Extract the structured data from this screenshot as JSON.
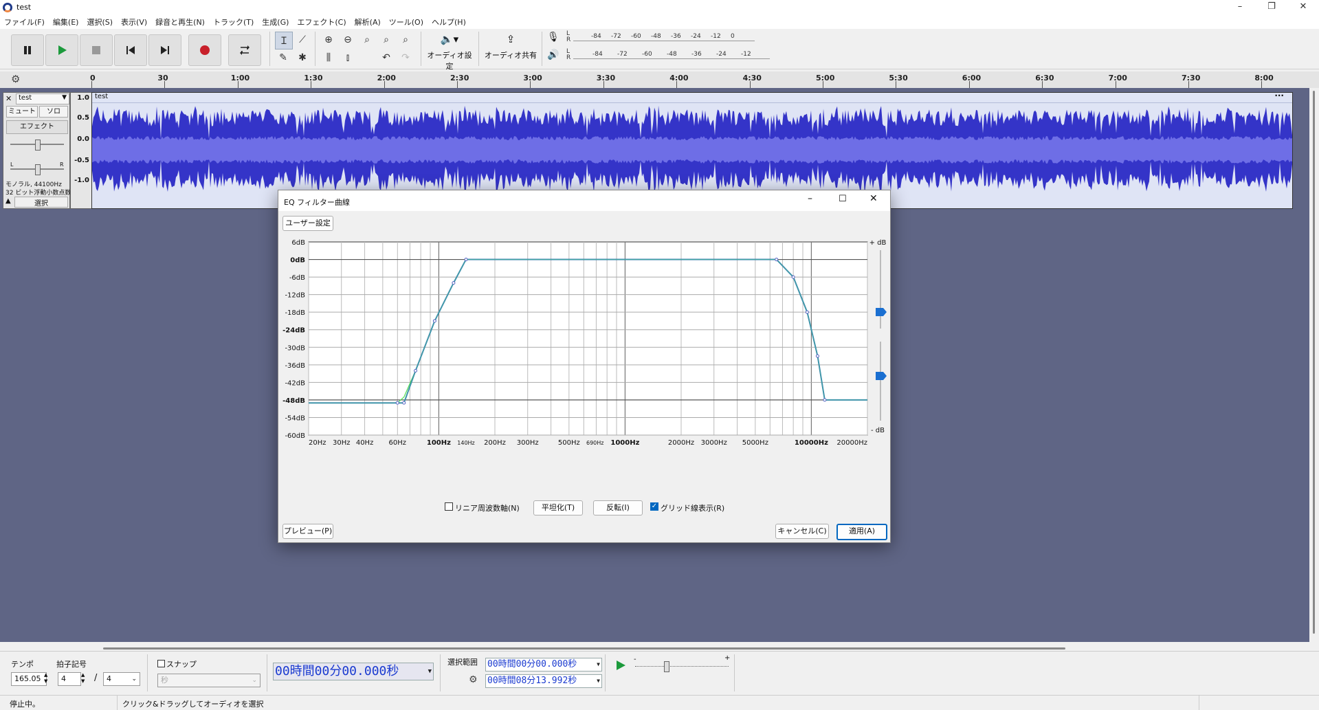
{
  "window": {
    "title": "test"
  },
  "menu": [
    "ファイル(F)",
    "編集(E)",
    "選択(S)",
    "表示(V)",
    "録音と再生(N)",
    "トラック(T)",
    "生成(G)",
    "エフェクト(C)",
    "解析(A)",
    "ツール(O)",
    "ヘルプ(H)"
  ],
  "toolbar": {
    "audio_setup_label": "オーディオ設定",
    "share_audio_label": "オーディオ共有",
    "meter_ticks": [
      "-84",
      "-72",
      "-60",
      "-48",
      "-36",
      "-24",
      "-12",
      "0"
    ],
    "meter_ticks_play": [
      "-84",
      "-72",
      "-60",
      "-48",
      "-36",
      "-24",
      "-12"
    ],
    "meter_L": "L",
    "meter_R": "R"
  },
  "ruler": {
    "ticks": [
      "0",
      "30",
      "1:00",
      "1:30",
      "2:00",
      "2:30",
      "3:00",
      "3:30",
      "4:00",
      "4:30",
      "5:00",
      "5:30",
      "6:00",
      "6:30",
      "7:00",
      "7:30",
      "8:00"
    ]
  },
  "track": {
    "name": "test",
    "clip_name": "test",
    "mute": "ミュート",
    "solo": "ソロ",
    "effect": "エフェクト",
    "pan_L": "L",
    "pan_R": "R",
    "info1": "モノラル, 44100Hz",
    "info2": "32 ビット浮動小数点数",
    "select": "選択",
    "scale": [
      "1.0",
      "0.5",
      "0.0",
      "-0.5",
      "-1.0"
    ]
  },
  "dialog": {
    "title": "EQ フィルター曲線",
    "preset_button": "ユーザー設定",
    "db_labels": [
      "6dB",
      "0dB",
      "-6dB",
      "-12dB",
      "-18dB",
      "-24dB",
      "-30dB",
      "-36dB",
      "-42dB",
      "-48dB",
      "-54dB",
      "-60dB"
    ],
    "freq_labels": [
      "20Hz",
      "30Hz",
      "40Hz",
      "60Hz",
      "100Hz",
      "140Hz",
      "200Hz",
      "300Hz",
      "500Hz",
      "690Hz",
      "1000Hz",
      "2000Hz",
      "3000Hz",
      "5000Hz",
      "10000Hz",
      "20000Hz"
    ],
    "plus_db": "+ dB",
    "minus_db": "- dB",
    "linear_freq_label": "リニア周波数軸(N)",
    "linear_freq_checked": false,
    "flatten_button": "平坦化(T)",
    "invert_button": "反転(I)",
    "grid_label": "グリッド線表示(R)",
    "grid_checked": true,
    "preview_button": "プレビュー(P)",
    "cancel_button": "キャンセル(C)",
    "apply_button": "適用(A)"
  },
  "chart_data": {
    "type": "line",
    "xscale": "log",
    "xlim": [
      20,
      20000
    ],
    "ylim": [
      -60,
      6
    ],
    "xlabel": "",
    "ylabel": "",
    "series": [
      {
        "x": [
          20,
          60,
          65,
          75,
          95,
          120,
          140,
          6500,
          8000,
          9500,
          10800,
          11800,
          20000
        ],
        "y": [
          -49,
          -49,
          -49,
          -38,
          -21,
          -8,
          0,
          0,
          -6,
          -18,
          -33,
          -48,
          -48
        ]
      }
    ],
    "control_points": {
      "x": [
        60,
        65,
        75,
        95,
        120,
        140,
        6500,
        8000,
        9500,
        10800,
        11800
      ],
      "y": [
        -49,
        -49,
        -38,
        -21,
        -8,
        0,
        0,
        -6,
        -18,
        -33,
        -48
      ]
    }
  },
  "bottom": {
    "tempo_label": "テンポ",
    "tempo_value": "165.05",
    "timesig_label": "拍子記号",
    "timesig_num": "4",
    "timesig_den": "4",
    "timesig_slash": "/",
    "snap_label": "スナップ",
    "snap_unit": "秒",
    "time_display": "00時間00分00.000秒",
    "selection_label": "選択範囲",
    "sel_start": "00時間00分00.000秒",
    "sel_end": "00時間08分13.992秒"
  },
  "status": {
    "state": "停止中。",
    "hint": "クリック&ドラッグしてオーディオを選択"
  }
}
